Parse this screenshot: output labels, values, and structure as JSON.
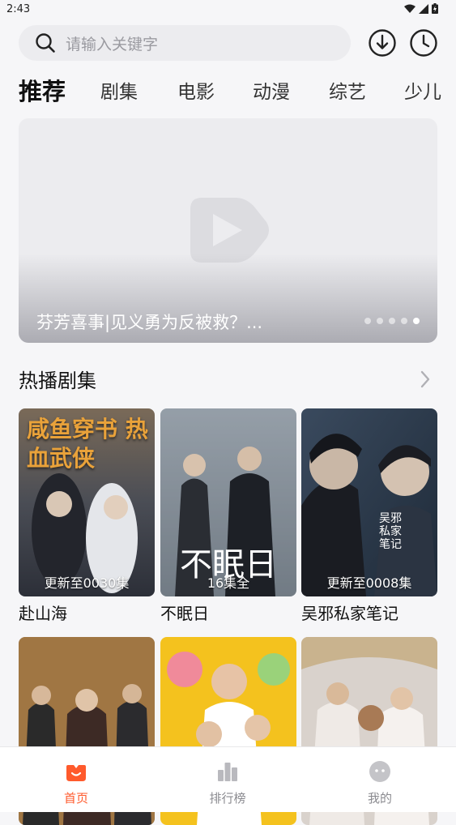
{
  "status": {
    "time": "2:43"
  },
  "search": {
    "placeholder": "请输入关键字"
  },
  "tabs": [
    {
      "label": "推荐",
      "active": true
    },
    {
      "label": "剧集"
    },
    {
      "label": "电影"
    },
    {
      "label": "动漫"
    },
    {
      "label": "综艺"
    },
    {
      "label": "少儿"
    }
  ],
  "banner": {
    "title": "芬芳喜事|见义勇为反被救？...",
    "dots_total": 5,
    "dot_active": 5
  },
  "section": {
    "title": "热播剧集"
  },
  "cards": [
    {
      "title": "赴山海",
      "badge": "更新至0030集",
      "poster_text": "咸鱼穿书 热血武侠"
    },
    {
      "title": "不眠日",
      "badge": "16集全",
      "poster_text": "不眠日"
    },
    {
      "title": "吴邪私家笔记",
      "badge": "更新至0008集",
      "poster_text": "吴邪私家笔记"
    },
    {
      "title": "",
      "badge": ""
    },
    {
      "title": "",
      "badge": ""
    },
    {
      "title": "",
      "badge": ""
    }
  ],
  "tabbar": [
    {
      "label": "首页",
      "icon": "home-icon",
      "active": true
    },
    {
      "label": "排行榜",
      "icon": "ranking-icon"
    },
    {
      "label": "我的",
      "icon": "profile-icon"
    }
  ],
  "colors": {
    "accent": "#ff5a2c",
    "background": "#f6f6f8"
  }
}
